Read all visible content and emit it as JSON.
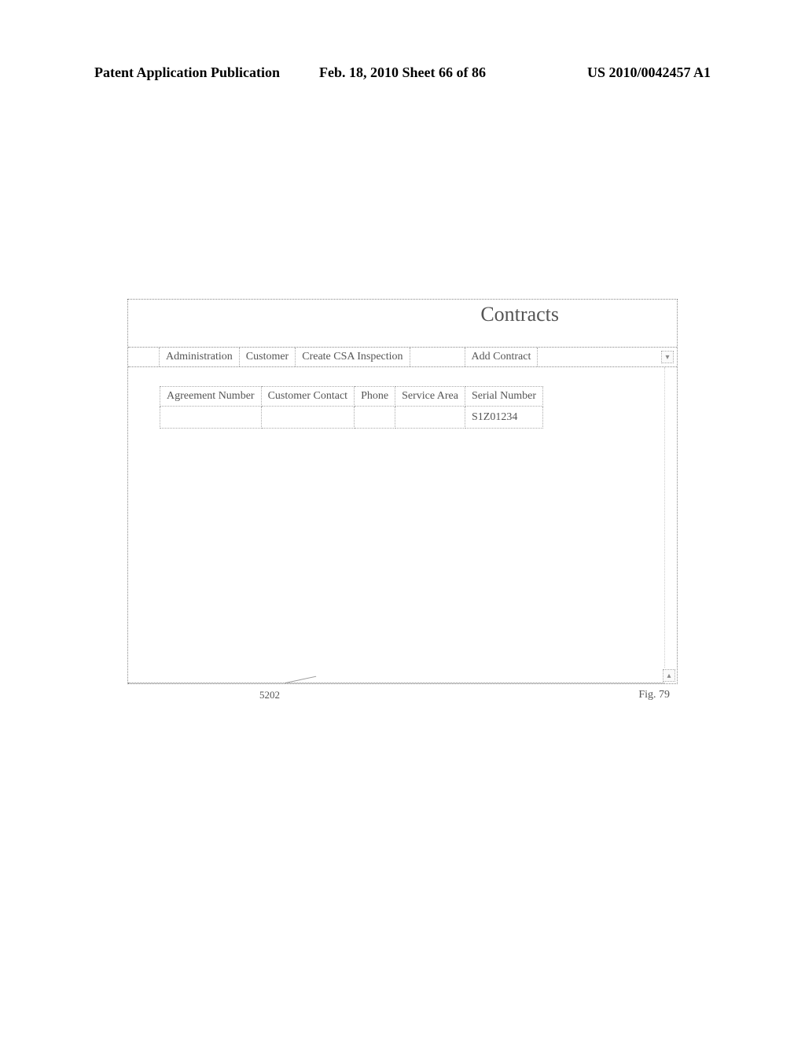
{
  "header": {
    "left": "Patent Application Publication",
    "center": "Feb. 18, 2010  Sheet 66 of 86",
    "right": "US 2010/0042457 A1"
  },
  "app": {
    "title": "Contracts",
    "toolbar": {
      "administration": "Administration",
      "customer": "Customer",
      "create_csa": "Create CSA Inspection",
      "add_contract": "Add Contract"
    },
    "table": {
      "headers": {
        "agreement_number": "Agreement Number",
        "customer_contact": "Customer Contact",
        "phone": "Phone",
        "service_area": "Service Area",
        "serial_number": "Serial Number"
      },
      "rows": [
        {
          "agreement_number": "",
          "customer_contact": "",
          "phone": "",
          "service_area": "",
          "serial_number": "S1Z01234"
        }
      ]
    }
  },
  "annotations": {
    "ref_number": "5202",
    "figure_label": "Fig. 79"
  }
}
